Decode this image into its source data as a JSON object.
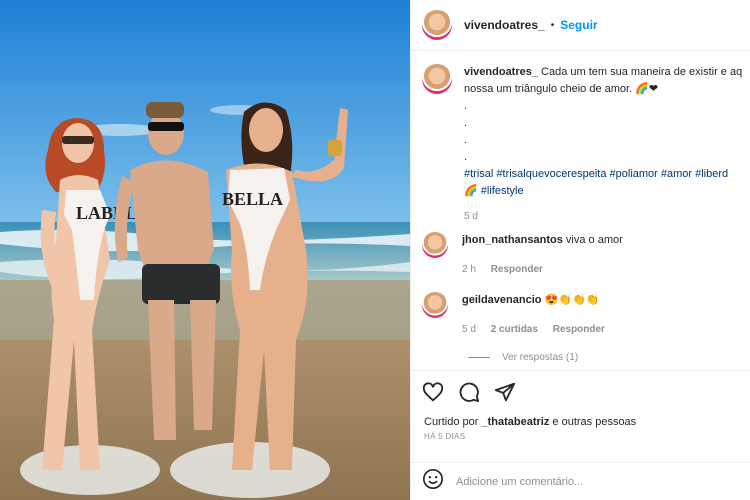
{
  "post_header": {
    "username": "vivendoatres_",
    "separator": "•",
    "follow_label": "Seguir"
  },
  "caption": {
    "username": "vivendoatres_",
    "line1": "Cada um tem sua maneira de existir e aq",
    "line2": "nossa um triângulo cheio de amor.",
    "emojis1": "🌈❤",
    "dots": [
      ".",
      " .",
      " .",
      " ."
    ],
    "hashtags": "#trisal #trisalquevocerespeita #poliamor #amor #liberd",
    "hashtags2": "#lifestyle",
    "rainbow": "🌈",
    "time": "5 d"
  },
  "comments": [
    {
      "username": "jhon_nathansantos",
      "text": "viva o amor",
      "time": "2 h",
      "reply_label": "Responder"
    },
    {
      "username": "geildavenancio",
      "text": "😍👏👏👏",
      "time": "5 d",
      "likes": "2 curtidas",
      "reply_label": "Responder"
    }
  ],
  "view_replies": "Ver respostas (1)",
  "likes_text": {
    "prefix": "Curtido por",
    "user": "_thatabeatriz",
    "suffix": "e outras pessoas"
  },
  "posted_ago": "HÁ 5 DIAS",
  "add_comment_placeholder": "Adicione um comentário...",
  "photo": {
    "sign_left": "LABELL",
    "sign_right": "BELLA"
  }
}
